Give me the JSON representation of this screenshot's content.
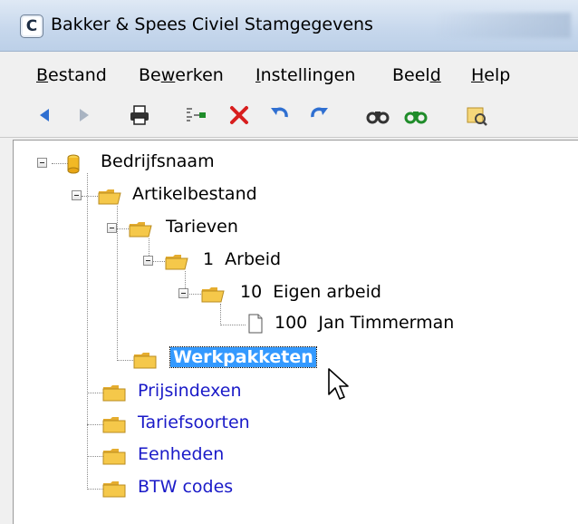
{
  "window": {
    "title": "Bakker & Spees Civiel Stamgegevens",
    "app_icon_glyph": "C"
  },
  "menu": [
    {
      "pre": "",
      "u": "B",
      "post": "estand"
    },
    {
      "pre": "Be",
      "u": "w",
      "post": "erken"
    },
    {
      "pre": "",
      "u": "I",
      "post": "nstellingen"
    },
    {
      "pre": "Beel",
      "u": "d",
      "post": ""
    },
    {
      "pre": "",
      "u": "H",
      "post": "elp"
    }
  ],
  "toolbar": {
    "icons": [
      "back-arrow-icon",
      "forward-arrow-icon",
      "print-icon",
      "insert-icon",
      "delete-icon",
      "undo-icon",
      "redo-icon",
      "find-icon",
      "find-next-icon",
      "properties-icon"
    ],
    "colors": {
      "blue": "#2f6fd1",
      "red": "#d81e1e",
      "green": "#1f8c2a"
    }
  },
  "tree": {
    "root": "Bedrijfsnaam",
    "artikelbestand": "Artikelbestand",
    "tarieven": "Tarieven",
    "arbeid": "1  Arbeid",
    "eigen_arbeid": "10  Eigen arbeid",
    "jan": "100  Jan Timmerman",
    "werkpakketen": "Werkpakketen",
    "prijsindexen": "Prijsindexen",
    "tariefsoorten": "Tariefsoorten",
    "eenheden": "Eenheden",
    "btw": "BTW codes",
    "colors": {
      "link": "#1a1ac8",
      "selection": "#3399ff",
      "folder": "#f5c84a"
    }
  }
}
